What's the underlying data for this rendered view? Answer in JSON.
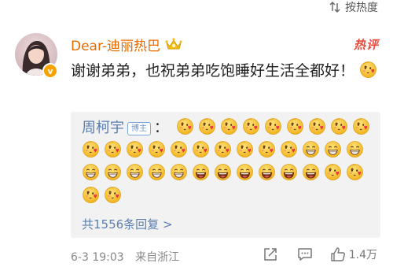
{
  "sort": {
    "label": "按热度"
  },
  "comment": {
    "username": "Dear-迪丽热巴",
    "hot_tag": "热评",
    "text": "谢谢弟弟，也祝弟弟吃饱睡好生活全都好！",
    "emoji": "heart-eyes-emoji",
    "verified_badge": "v"
  },
  "reply": {
    "name": "周柯宇",
    "badge": "博主",
    "colon": "：",
    "emojis": [
      "heart-face",
      "heart-face",
      "heart-face",
      "heart-face",
      "heart-face",
      "heart-face",
      "heart-face",
      "heart-face",
      "heart-face",
      "heart-face",
      "heart-face",
      "heart-face",
      "heart-face",
      "heart-face",
      "heart-face",
      "heart-face",
      "heart-face",
      "heart-face",
      "heart-face",
      "grin",
      "grin",
      "grin",
      "grin",
      "grin",
      "grin",
      "grin",
      "grin",
      "laugh",
      "laugh",
      "laugh",
      "laugh",
      "laugh",
      "laugh",
      "heart-face",
      "heart-face",
      "heart-face",
      "heart-face"
    ],
    "more": "共1556条回复 >"
  },
  "footer": {
    "date": "6-3 19:03",
    "location": "来自浙江",
    "likes": "1.4万"
  },
  "colors": {
    "username": "#e86a00",
    "link": "#5a7fb0",
    "hot": "#ea4a3b"
  }
}
